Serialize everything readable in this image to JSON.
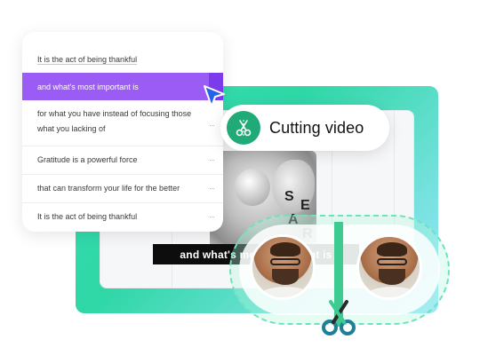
{
  "transcript": {
    "rows": [
      {
        "text": "It is the act of being thankful",
        "active": false
      },
      {
        "text": "and what's most important is",
        "active": true
      },
      {
        "text": "for what you have instead of focusing those what you lacking of",
        "active": false
      },
      {
        "text": "Gratitude is a powerful force",
        "active": false
      },
      {
        "text": "that can transform your life for the better",
        "active": false
      },
      {
        "text": "It is the act of being thankful",
        "active": false
      }
    ],
    "more_glyph": "···"
  },
  "action_pill": {
    "label": "Cutting video",
    "icon": "scissors-icon",
    "icon_color": "#1faa78"
  },
  "preview": {
    "caption": "and what's most important is",
    "floating_letters": [
      "S",
      "E",
      "A",
      "R"
    ]
  },
  "colors": {
    "accent_purple": "#9b5cf6",
    "accent_green": "#2fd7a6",
    "cursor_blue": "#2563eb"
  }
}
